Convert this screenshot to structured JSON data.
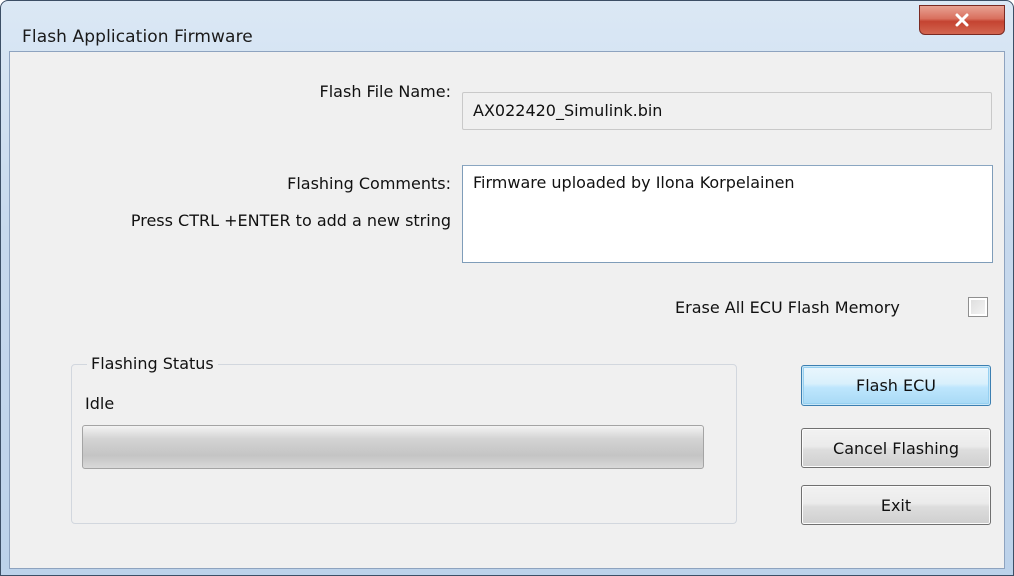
{
  "window": {
    "title": "Flash Application Firmware"
  },
  "icons": {
    "close": "close-icon"
  },
  "form": {
    "file_name_label": "Flash File Name:",
    "file_name_value": "AX022420_Simulink.bin",
    "comments_label": "Flashing Comments:",
    "comments_hint": "Press CTRL +ENTER to add a new string",
    "comments_value": "Firmware uploaded by Ilona Korpelainen",
    "erase_label": "Erase All ECU Flash Memory",
    "erase_checked": false
  },
  "status": {
    "group_title": "Flashing Status",
    "text": "Idle",
    "progress": 0
  },
  "buttons": {
    "flash": "Flash ECU",
    "cancel": "Cancel Flashing",
    "exit": "Exit"
  },
  "colors": {
    "title_bar": "#c7d9ed",
    "close_button": "#c44331",
    "dialog_background": "#f0f0f0",
    "default_button_border": "#3c7fb1"
  }
}
